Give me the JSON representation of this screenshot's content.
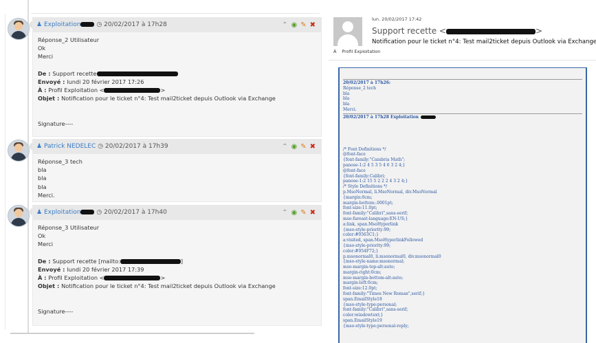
{
  "left": {
    "entries": [
      {
        "author": "Exploitation",
        "datetime": "20/02/2017 à 17h28",
        "lines": [
          {
            "t": "Réponse_2 Utilisateur"
          },
          {
            "t": "Ok"
          },
          {
            "t": "Merci"
          },
          {
            "t": ""
          },
          {
            "label": "De : ",
            "t": "Support recette",
            "redact": 118
          },
          {
            "label": "Envoyé : ",
            "t": "lundi 20 février 2017 17:26"
          },
          {
            "label": "À : ",
            "t": "Profil Exploitation <",
            "redact": 82,
            "suffix": ">"
          },
          {
            "label": "Objet : ",
            "t": "Notification pour le ticket n°4: Test mail2ticket depuis Outlook via Exchange"
          },
          {
            "t": ""
          },
          {
            "t": ""
          },
          {
            "t": "Signature----"
          }
        ]
      },
      {
        "author": "Patrick NEDELEC",
        "datetime": "20/02/2017 à 17h39",
        "lines": [
          {
            "t": "Réponse_3 tech"
          },
          {
            "t": "bla"
          },
          {
            "t": "bla"
          },
          {
            "t": "bla"
          },
          {
            "t": "Merci."
          }
        ]
      },
      {
        "author": "Exploitation",
        "datetime": "20/02/2017 à 17h40",
        "lines": [
          {
            "t": "Réponse_3 Utilisateur"
          },
          {
            "t": "Ok"
          },
          {
            "t": "Merci"
          },
          {
            "t": ""
          },
          {
            "label": "De : ",
            "t": "Support recette [mailto:",
            "redact": 88,
            "suffix": "]"
          },
          {
            "label": "Envoyé : ",
            "t": "lundi 20 février 2017 17:39"
          },
          {
            "label": "À : ",
            "t": "Profil Exploitation <",
            "redact": 82,
            "suffix": ">"
          },
          {
            "label": "Objet : ",
            "t": "Notification pour le ticket n°4: Test mail2ticket depuis Outlook via Exchange"
          },
          {
            "t": ""
          },
          {
            "t": ""
          },
          {
            "t": "Signature----"
          }
        ]
      }
    ]
  },
  "right": {
    "date": "lun. 20/02/2017 17:42",
    "sender": "Support recette <",
    "subject": "Notification pour le ticket n°4: Test mail2ticket depuis Outlook via Exchange",
    "to_label": "À",
    "to_value": "Profil Exploitation",
    "body": [
      {
        "sep": true
      },
      {
        "t": "20/02/2017 à 17h26:",
        "bold": true
      },
      {
        "t": "Réponse_2 tech"
      },
      {
        "t": "bla"
      },
      {
        "t": "bla"
      },
      {
        "t": "bla"
      },
      {
        "t": "Merci."
      },
      {
        "sep": true
      },
      {
        "t": "20/02/2017 à 17h28 Exploitation",
        "bold": true,
        "redact": 22
      },
      {
        "t": ""
      },
      {
        "t": ""
      },
      {
        "t": ""
      },
      {
        "t": ""
      },
      {
        "t": ""
      },
      {
        "t": "/* Font Definitions */"
      },
      {
        "t": "@font-face"
      },
      {
        "t": "{font-family:\"Cambria Math\";"
      },
      {
        "t": "panose-1:2 4 5 3 5 4 6 3 2 4;}"
      },
      {
        "t": "@font-face"
      },
      {
        "t": "{font-family:Calibri;"
      },
      {
        "t": "panose-1:2 15 5 2 2 2 4 3 2 4;}"
      },
      {
        "t": "/* Style Definitions */"
      },
      {
        "t": "p.MsoNormal, li.MsoNormal, div.MsoNormal"
      },
      {
        "t": "{margin:0cm;"
      },
      {
        "t": "margin-bottom:.0001pt;"
      },
      {
        "t": "font-size:11.0pt;"
      },
      {
        "t": "font-family:\"Calibri\",sans-serif;"
      },
      {
        "t": "mso-fareast-language:EN-US;}"
      },
      {
        "t": "a:link, span.MsoHyperlink"
      },
      {
        "t": "{mso-style-priority:99;"
      },
      {
        "t": "color:#0563C1;}"
      },
      {
        "t": "a:visited, span.MsoHyperlinkFollowed"
      },
      {
        "t": "{mso-style-priority:99;"
      },
      {
        "t": "color:#954F72;}"
      },
      {
        "t": "p.msonormal0, li.msonormal0, div.msonormal0"
      },
      {
        "t": "{mso-style-name:msonormal;"
      },
      {
        "t": "mso-margin-top-alt:auto;"
      },
      {
        "t": "margin-right:0cm;"
      },
      {
        "t": "mso-margin-bottom-alt:auto;"
      },
      {
        "t": "margin-left:0cm;"
      },
      {
        "t": "font-size:12.0pt;"
      },
      {
        "t": "font-family:\"Times New Roman\",serif;}"
      },
      {
        "t": "span.EmailStyle18"
      },
      {
        "t": "{mso-style-type:personal;"
      },
      {
        "t": "font-family:\"Calibri\",sans-serif;"
      },
      {
        "t": "color:windowtext;}"
      },
      {
        "t": "span.EmailStyle19"
      },
      {
        "t": "{mso-style-type:personal-reply;"
      }
    ]
  },
  "icons": {
    "user": "user-icon",
    "clock": "clock-icon",
    "collapse": "chevron-up-icon",
    "view": "eye-icon",
    "edit": "pencil-icon",
    "delete": "close-icon"
  },
  "colors": {
    "author": "#3a7cc6",
    "eye": "#5aa02c",
    "pencil": "#e07b18",
    "delete": "#cc2a1a",
    "mail_border": "#3a67a7",
    "mail_text": "#2a55a0"
  }
}
